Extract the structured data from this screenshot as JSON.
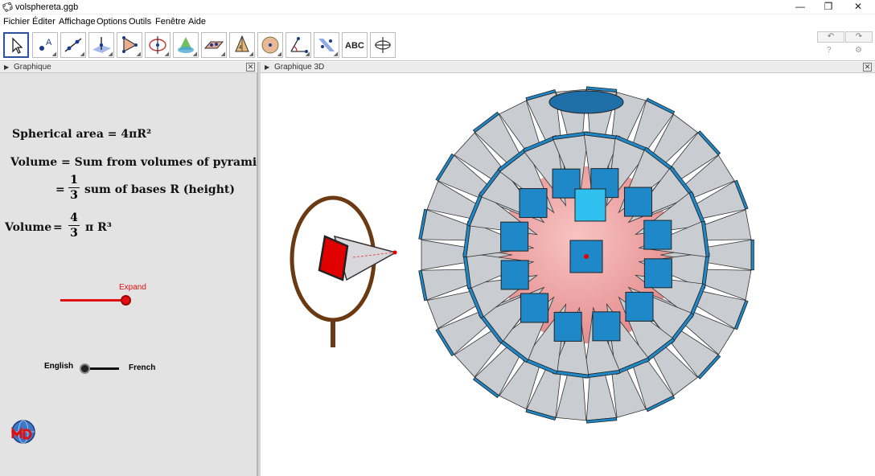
{
  "window": {
    "title": "volsphereta.ggb",
    "minimize": "—",
    "restore": "❐",
    "close": "✕"
  },
  "menu": [
    "Fichier",
    "Éditer",
    "Affichage",
    "Options",
    "Outils",
    "Fenêtre",
    "Aide"
  ],
  "toolbar": {
    "tools": [
      {
        "icon": "move-arrow-icon"
      },
      {
        "icon": "point-icon"
      },
      {
        "icon": "line-icon"
      },
      {
        "icon": "perpendicular-line-icon"
      },
      {
        "icon": "polygon-icon"
      },
      {
        "icon": "circle-axis-icon"
      },
      {
        "icon": "plane-intersect-icon"
      },
      {
        "icon": "plane-points-icon"
      },
      {
        "icon": "pyramid-icon"
      },
      {
        "icon": "sphere-icon"
      },
      {
        "icon": "angle-icon"
      },
      {
        "icon": "reflect-plane-icon"
      },
      {
        "icon": "text-icon",
        "text": "ABC"
      },
      {
        "icon": "rotate-view-icon"
      }
    ],
    "undo_icon": "↶",
    "redo_icon": "↷",
    "help_icon": "?",
    "settings_icon": "⚙"
  },
  "graphics_panel": {
    "title": "Graphique",
    "close": "✕",
    "spherical_area": "Spherical area = 4πR²",
    "volume_line1": "Volume = Sum from volumes of pyramids",
    "eq_sign": "=",
    "frac_1_num": "1",
    "frac_1_den": "3",
    "volume_line2_text": "sum of bases R (height)",
    "volume_label": "Volume",
    "frac_4_num": "4",
    "frac_4_den": "3",
    "pi_r3": "π R³",
    "expand_label": "Expand",
    "expand_value": 1.0,
    "lang_left": "English",
    "lang_right": "French",
    "lang_value": 0,
    "colors": {
      "expand_slider": "#e01010",
      "background": "#e3e3e3"
    }
  },
  "graphics3d_panel": {
    "title": "Graphique 3D",
    "close": "✕",
    "colors": {
      "pyramid_face": "#1e88c8",
      "pyramid_side": "#c9ccd0",
      "sphere": "#f08a8a",
      "loupe_ring": "#6b3a12",
      "highlight_face": "#e00000"
    }
  }
}
